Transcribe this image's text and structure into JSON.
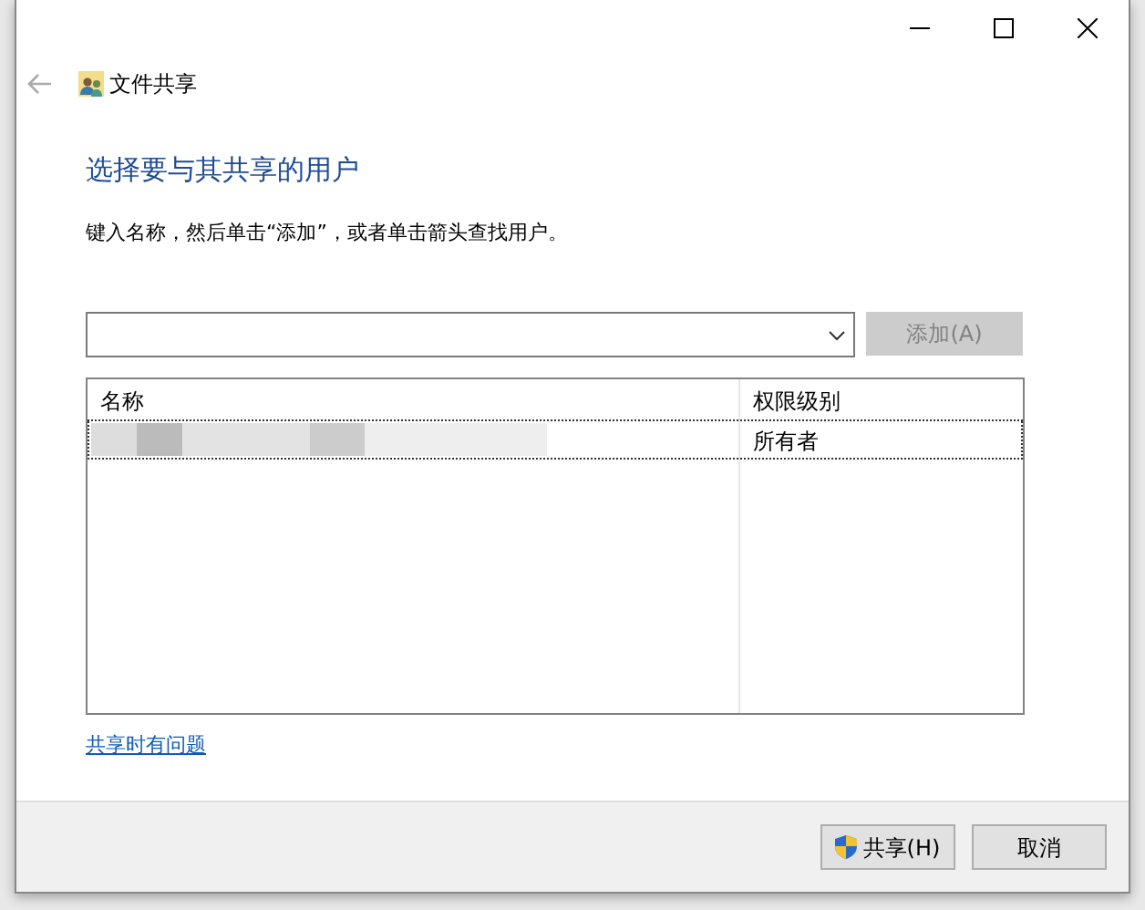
{
  "window": {
    "title": "文件共享"
  },
  "heading": "选择要与其共享的用户",
  "instruction": "键入名称，然后单击“添加”，或者单击箭头查找用户。",
  "add_button": {
    "label": "添加(A)",
    "disabled": true
  },
  "table": {
    "columns": [
      "名称",
      "权限级别"
    ],
    "rows": [
      {
        "name_redacted": true,
        "permission": "所有者",
        "selected": true
      }
    ]
  },
  "help_link": "共享时有问题",
  "buttons": [
    {
      "label": "共享(H)",
      "kind": "shield"
    },
    {
      "label": "取消",
      "kind": "plain"
    }
  ]
}
